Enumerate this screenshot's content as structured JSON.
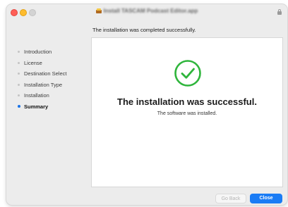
{
  "window": {
    "title": "Install TASCAM Podcast Editor.app"
  },
  "header": {
    "message": "The installation was completed successfully."
  },
  "sidebar": {
    "steps": [
      {
        "label": "Introduction"
      },
      {
        "label": "License"
      },
      {
        "label": "Destination Select"
      },
      {
        "label": "Installation Type"
      },
      {
        "label": "Installation"
      },
      {
        "label": "Summary"
      }
    ],
    "active_index": 5
  },
  "main": {
    "success_title": "The installation was successful.",
    "success_subtitle": "The software was installed."
  },
  "buttons": {
    "go_back": "Go Back",
    "close": "Close"
  },
  "colors": {
    "accent": "#1a7cf5",
    "success": "#2fb53c",
    "close_dot": "#ff5f57",
    "minimize_dot": "#febc2e"
  },
  "icons": {
    "package": "package-icon",
    "lock": "lock-icon",
    "success": "checkmark-circle-icon"
  }
}
